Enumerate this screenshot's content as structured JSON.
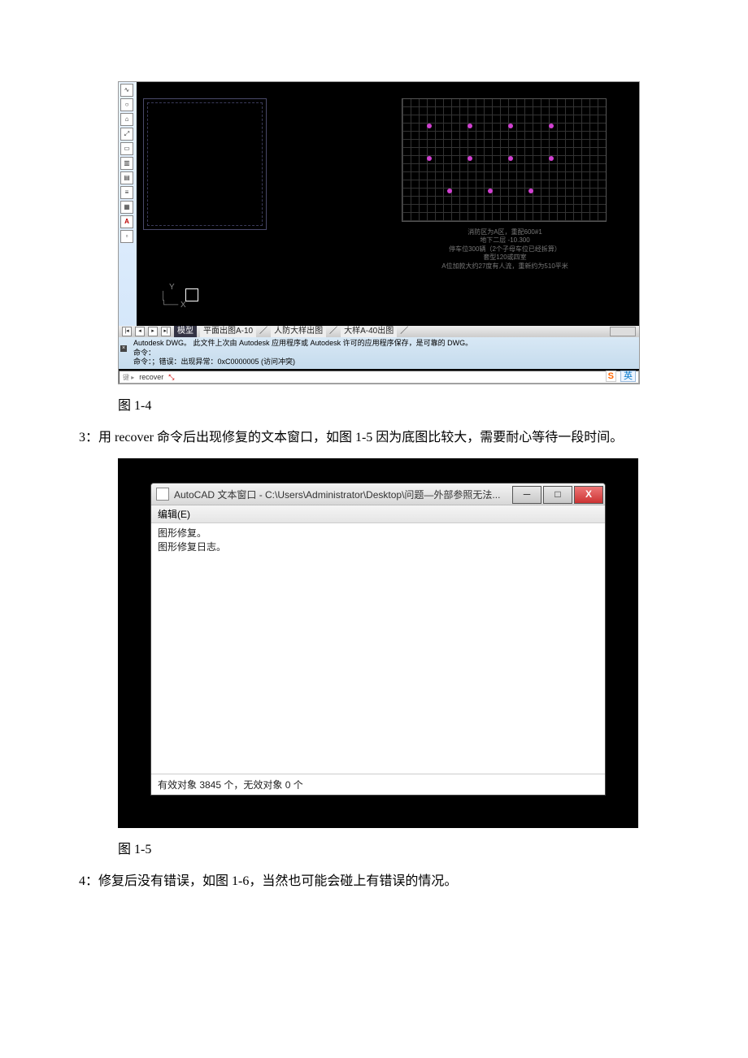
{
  "figure1": {
    "tabs": {
      "model": "模型",
      "layout1": "平面出图A-10",
      "layout2": "人防大样出图",
      "layout3": "大样A-40出图"
    },
    "cmd": {
      "line1": "Autodesk DWG。   此文件上次由 Autodesk 应用程序或 Autodesk 许可的应用程序保存，是可靠的 DWG。",
      "line2": "命令：",
      "line3": "命令：；错误：出现异常：0xC0000005 (访问冲突)",
      "input_prefix": "键 ▸",
      "input_text": "recover"
    },
    "annotation": {
      "l1": "消防区为A区，重配600#1",
      "l2": "地下二层  -10.300",
      "l3": "停车位300辆（2个子母车位已经拆算）",
      "l4": "套型120或四室",
      "l5": "A位加款大约27度有人流，重新约为510平米"
    },
    "ucs_y": "Y",
    "ucs_x": "X",
    "ime": {
      "s": "S",
      "cn": "英"
    }
  },
  "caption1": "图 1-4",
  "para3": "3：用 recover 命令后出现修复的文本窗口，如图 1-5 因为底图比较大，需要耐心等待一段时间。",
  "figure2": {
    "title": "AutoCAD 文本窗口 - C:\\Users\\Administrator\\Desktop\\问题—外部参照无法...",
    "menu_edit": "编辑(E)",
    "body_l1": "图形修复。",
    "body_l2": "图形修复日志。",
    "status": "有效对象 3845   个，无效对象 0       个"
  },
  "caption2": "图 1-5",
  "para4": "4：修复后没有错误，如图 1-6，当然也可能会碰上有错误的情况。"
}
